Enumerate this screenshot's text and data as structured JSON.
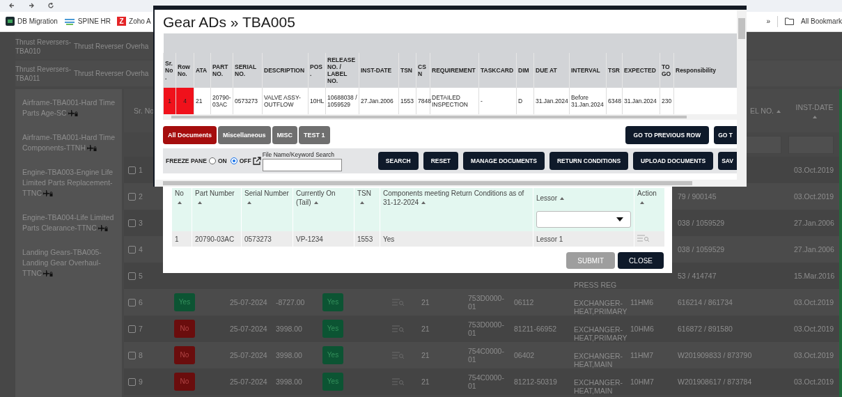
{
  "bookmarks": [
    {
      "label": "DB Migration",
      "kind": "square"
    },
    {
      "label": "SPINE HR",
      "kind": "wave"
    },
    {
      "label": "Zoho A",
      "kind": "letter",
      "badge": "Z"
    }
  ],
  "bookmarks_overflow": "»",
  "bookmarks_folder": "All Bookmark",
  "top_list": [
    {
      "group": "Thrust Reversers-TBA010",
      "task": "Thrust Reverser Overha"
    },
    {
      "group": "Thrust Reversers-TBA011",
      "task": "Thrust Reverser Overha"
    }
  ],
  "sidebar": {
    "items": [
      {
        "label": "Airframe-TBA001-Hard Time Parts Age-SC"
      },
      {
        "label": "Airframe-TBA001-Hard Time Components-TTNH"
      },
      {
        "label": "Engine-TBA003-Engine Life Limited Parts Replacement-TTNC"
      },
      {
        "label": "Engine-TBA004-Life Limited Parts Clearance-TTNC"
      },
      {
        "label": "Landing Gears-TBA005-Landing Gear Overhaul-TTNC"
      }
    ]
  },
  "table": {
    "header": {
      "sr": {
        "text": "Sr. No"
      },
      "label_no": {
        "text": "EL NO.",
        "sortable": true
      },
      "inst_date": {
        "text": "INST-DATE",
        "sortable": true
      }
    },
    "rows": [
      {
        "sr": "1",
        "checked": false,
        "inst_date": "03.Oct.2019"
      },
      {
        "sr": "2",
        "checked": false,
        "label_no": "79 / 900145",
        "inst_date": "03.Oct.2019"
      },
      {
        "sr": "3",
        "checked": false,
        "label_no": "038 / 1059529",
        "inst_date": "27.Jan.2006"
      },
      {
        "sr": "4",
        "checked": false,
        "label_no": "038 / 1059529",
        "inst_date": "27.Jan.2006"
      },
      {
        "sr": "5",
        "checked": false,
        "description": "PRESS REG",
        "label_no": "53 / 414747",
        "inst_date": "15.Mar.2016"
      },
      {
        "sr": "6",
        "checked": false,
        "status": {
          "text": "Yes",
          "kind": "yes"
        },
        "date": "25-07-2024",
        "amount": "-8727.00",
        "status2": {
          "text": "Yes",
          "kind": "yes"
        },
        "docs_icon": true,
        "ata": "21",
        "part": "753D0000-01",
        "serial": "06112",
        "description": "EXCHANGER-HEAT,PRIMARY",
        "pos": "11HM6",
        "label_no": "616214 / 861734",
        "inst_date": "03.Oct.2019"
      },
      {
        "sr": "7",
        "checked": false,
        "status": {
          "text": "No",
          "kind": "no"
        },
        "date": "25-07-2024",
        "amount": "3998.00",
        "status2": {
          "text": "Yes",
          "kind": "yes"
        },
        "docs_icon": true,
        "ata": "21",
        "part": "753D0000-01",
        "serial": "81211-66952",
        "description": "EXCHANGER-HEAT,PRIMARY",
        "pos": "10HM6",
        "label_no": "616872 / 891580",
        "inst_date": "03.Oct.2019"
      },
      {
        "sr": "8",
        "checked": false,
        "status": {
          "text": "No",
          "kind": "no"
        },
        "date": "25-07-2024",
        "amount": "3998.00",
        "status2": {
          "text": "Yes",
          "kind": "yes"
        },
        "docs_icon": true,
        "ata": "21",
        "part": "754C0000-01",
        "serial": "06402",
        "description": "EXCHANGER-HEAT,MAIN",
        "pos": "11HM7",
        "label_no": "W201909833 / 873790",
        "inst_date": "03.Oct.2019"
      },
      {
        "sr": "9",
        "checked": false,
        "status": {
          "text": "No",
          "kind": "no"
        },
        "date": "25-07-2024",
        "amount": "3998.00",
        "status2": {
          "text": "Yes",
          "kind": "yes"
        },
        "docs_icon": true,
        "ata": "21",
        "part": "754C0000-01",
        "serial": "81212-50319",
        "description": "EXCHANGER-HEAT,MAIN",
        "pos": "10HM7",
        "label_no": "W201908617 / 873784",
        "inst_date": "03.Oct.2019"
      }
    ]
  },
  "ads_dialog": {
    "title": "Gear ADs » TBA005",
    "columns": [
      "Sr. No.",
      "Row No.",
      "ATA",
      "PART NO.",
      "SERIAL NO.",
      "DESCRIPTION",
      "POS.",
      "RELEASE NO. / LABEL NO.",
      "INST-DATE",
      "TSN",
      "CSN",
      "REQUIREMENT",
      "TASKCARD",
      "DIM",
      "DUE AT",
      "INTERVAL",
      "TSR",
      "EXPECTED",
      "TO GO",
      "Responsibility"
    ],
    "row": [
      {
        "text": "1",
        "flagged": true
      },
      {
        "text": "4",
        "flagged": true
      },
      {
        "text": "21",
        "flagged": false
      },
      {
        "text": "20790-03AC",
        "flagged": false
      },
      {
        "text": "0573273",
        "flagged": false
      },
      {
        "text": "VALVE ASSY-OUTFLOW",
        "flagged": false
      },
      {
        "text": "10HL",
        "flagged": false
      },
      {
        "text": "10688038 / 1059529",
        "flagged": false
      },
      {
        "text": "27.Jan.2006",
        "flagged": false
      },
      {
        "text": "1553",
        "flagged": false
      },
      {
        "text": "7848",
        "flagged": false
      },
      {
        "text": "DETAILED INSPECTION",
        "flagged": false
      },
      {
        "text": "-",
        "flagged": false
      },
      {
        "text": "D",
        "flagged": false
      },
      {
        "text": "31.Jan.2024",
        "flagged": false
      },
      {
        "text": "Before 31.Jan.2024",
        "flagged": false
      },
      {
        "text": "6348",
        "flagged": false
      },
      {
        "text": "31.Jan.2024",
        "flagged": false
      },
      {
        "text": "230",
        "flagged": false
      }
    ],
    "tabs": [
      {
        "label": "All Documents",
        "selected": true
      },
      {
        "label": "Miscellaneous",
        "selected": false
      },
      {
        "label": "MISC",
        "selected": false
      },
      {
        "label": "TEST 1",
        "selected": false
      }
    ],
    "nav_buttons": [
      "GO TO PREVIOUS ROW",
      "GO T"
    ],
    "freeze_pane": {
      "label": "FREEZE PANE",
      "options": [
        {
          "label": "ON",
          "selected": false
        },
        {
          "label": "OFF",
          "selected": true
        }
      ]
    },
    "search": {
      "label": "File Name/Keyword Search"
    },
    "actions": [
      "SEARCH",
      "RESET",
      "MANAGE DOCUMENTS",
      "RETURN CONDITIONS",
      "UPLOAD DOCUMENTS",
      "SAV"
    ]
  },
  "return_dialog": {
    "columns": [
      {
        "label": "No",
        "kind": "text"
      },
      {
        "label": "Part Number",
        "kind": "text"
      },
      {
        "label": "Serial Number",
        "kind": "text"
      },
      {
        "label": "Currently On (Tail)",
        "kind": "text"
      },
      {
        "label": "TSN",
        "kind": "text"
      },
      {
        "label": "Components meeting Return Conditions as of 31-12-2024",
        "kind": "text"
      },
      {
        "label": "Lessor",
        "kind": "select"
      },
      {
        "label": "Action",
        "kind": "action"
      }
    ],
    "rows": [
      {
        "cells": [
          "1",
          "20790-03AC",
          "0573273",
          "VP-1234",
          "1553",
          "Yes",
          "Lessor 1"
        ]
      }
    ],
    "buttons": [
      {
        "label": "SUBMIT",
        "disabled": true
      },
      {
        "label": "CLOSE",
        "disabled": false
      }
    ]
  }
}
